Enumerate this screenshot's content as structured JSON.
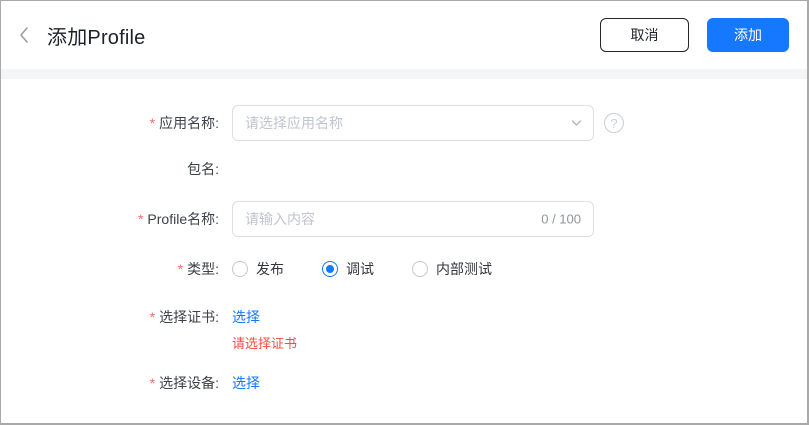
{
  "required_mark": "*",
  "colors": {
    "accent": "#1677ff",
    "error": "#f54c44",
    "asterisk": "#f56c6c",
    "border": "#dcdfe6",
    "divider_band": "#f4f5f6"
  },
  "header": {
    "title": "添加Profile",
    "cancel_button": "取消",
    "add_button": "添加"
  },
  "form": {
    "app_name": {
      "label": "应用名称:",
      "placeholder": "请选择应用名称",
      "help_icon": "?"
    },
    "package_name": {
      "label": "包名:",
      "value": ""
    },
    "profile_name": {
      "label": "Profile名称:",
      "placeholder": "请输入内容",
      "counter": "0 / 100"
    },
    "type": {
      "label": "类型:",
      "options": [
        {
          "label": "发布",
          "selected": false
        },
        {
          "label": "调试",
          "selected": true
        },
        {
          "label": "内部测试",
          "selected": false
        }
      ]
    },
    "certificate": {
      "label": "选择证书:",
      "link": "选择",
      "error": "请选择证书"
    },
    "device": {
      "label": "选择设备:",
      "link": "选择"
    }
  }
}
